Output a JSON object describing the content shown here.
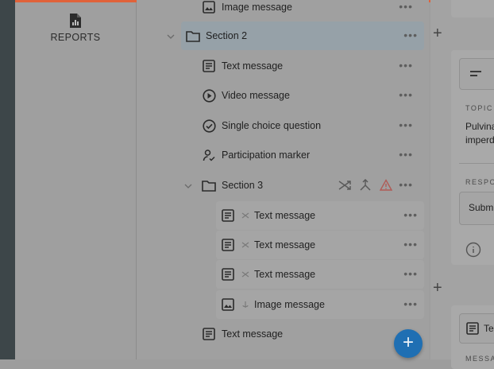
{
  "nav": {
    "reports_label": "REPORTS",
    "reports_icon": "report-document-icon"
  },
  "tree": {
    "rows": [
      {
        "label": "Image message",
        "icon": "image-icon"
      },
      {
        "label": "Section 2",
        "icon": "folder-icon"
      },
      {
        "label": "Text message",
        "icon": "text-message-icon"
      },
      {
        "label": "Video message",
        "icon": "play-circle-icon"
      },
      {
        "label": "Single choice question",
        "icon": "check-circle-icon"
      },
      {
        "label": "Participation marker",
        "icon": "person-check-icon"
      },
      {
        "label": "Section 3",
        "icon": "folder-icon"
      },
      {
        "label": "Text message",
        "icon": "text-message-icon"
      },
      {
        "label": "Text message",
        "icon": "text-message-icon"
      },
      {
        "label": "Text message",
        "icon": "text-message-icon"
      },
      {
        "label": "Image message",
        "icon": "image-icon"
      },
      {
        "label": "Text message",
        "icon": "text-message-icon"
      }
    ],
    "more_glyph": "•••",
    "section_tools": [
      "shuffle-icon",
      "split-icon",
      "warning-icon"
    ],
    "fab_label": "+"
  },
  "right_panel": {
    "plus_glyph": "+",
    "topic_label": "TOPIC",
    "topic_text_line1": "Pulvina",
    "topic_text_line2": "imperd",
    "response_label": "RESPO",
    "response_value": "Submi",
    "bottom_card_label": "Te",
    "bottom_card_caption": "MESSA"
  },
  "colors": {
    "accent": "#1f6fb3",
    "top_accent": "#e0623a",
    "warning": "#c0504d"
  }
}
